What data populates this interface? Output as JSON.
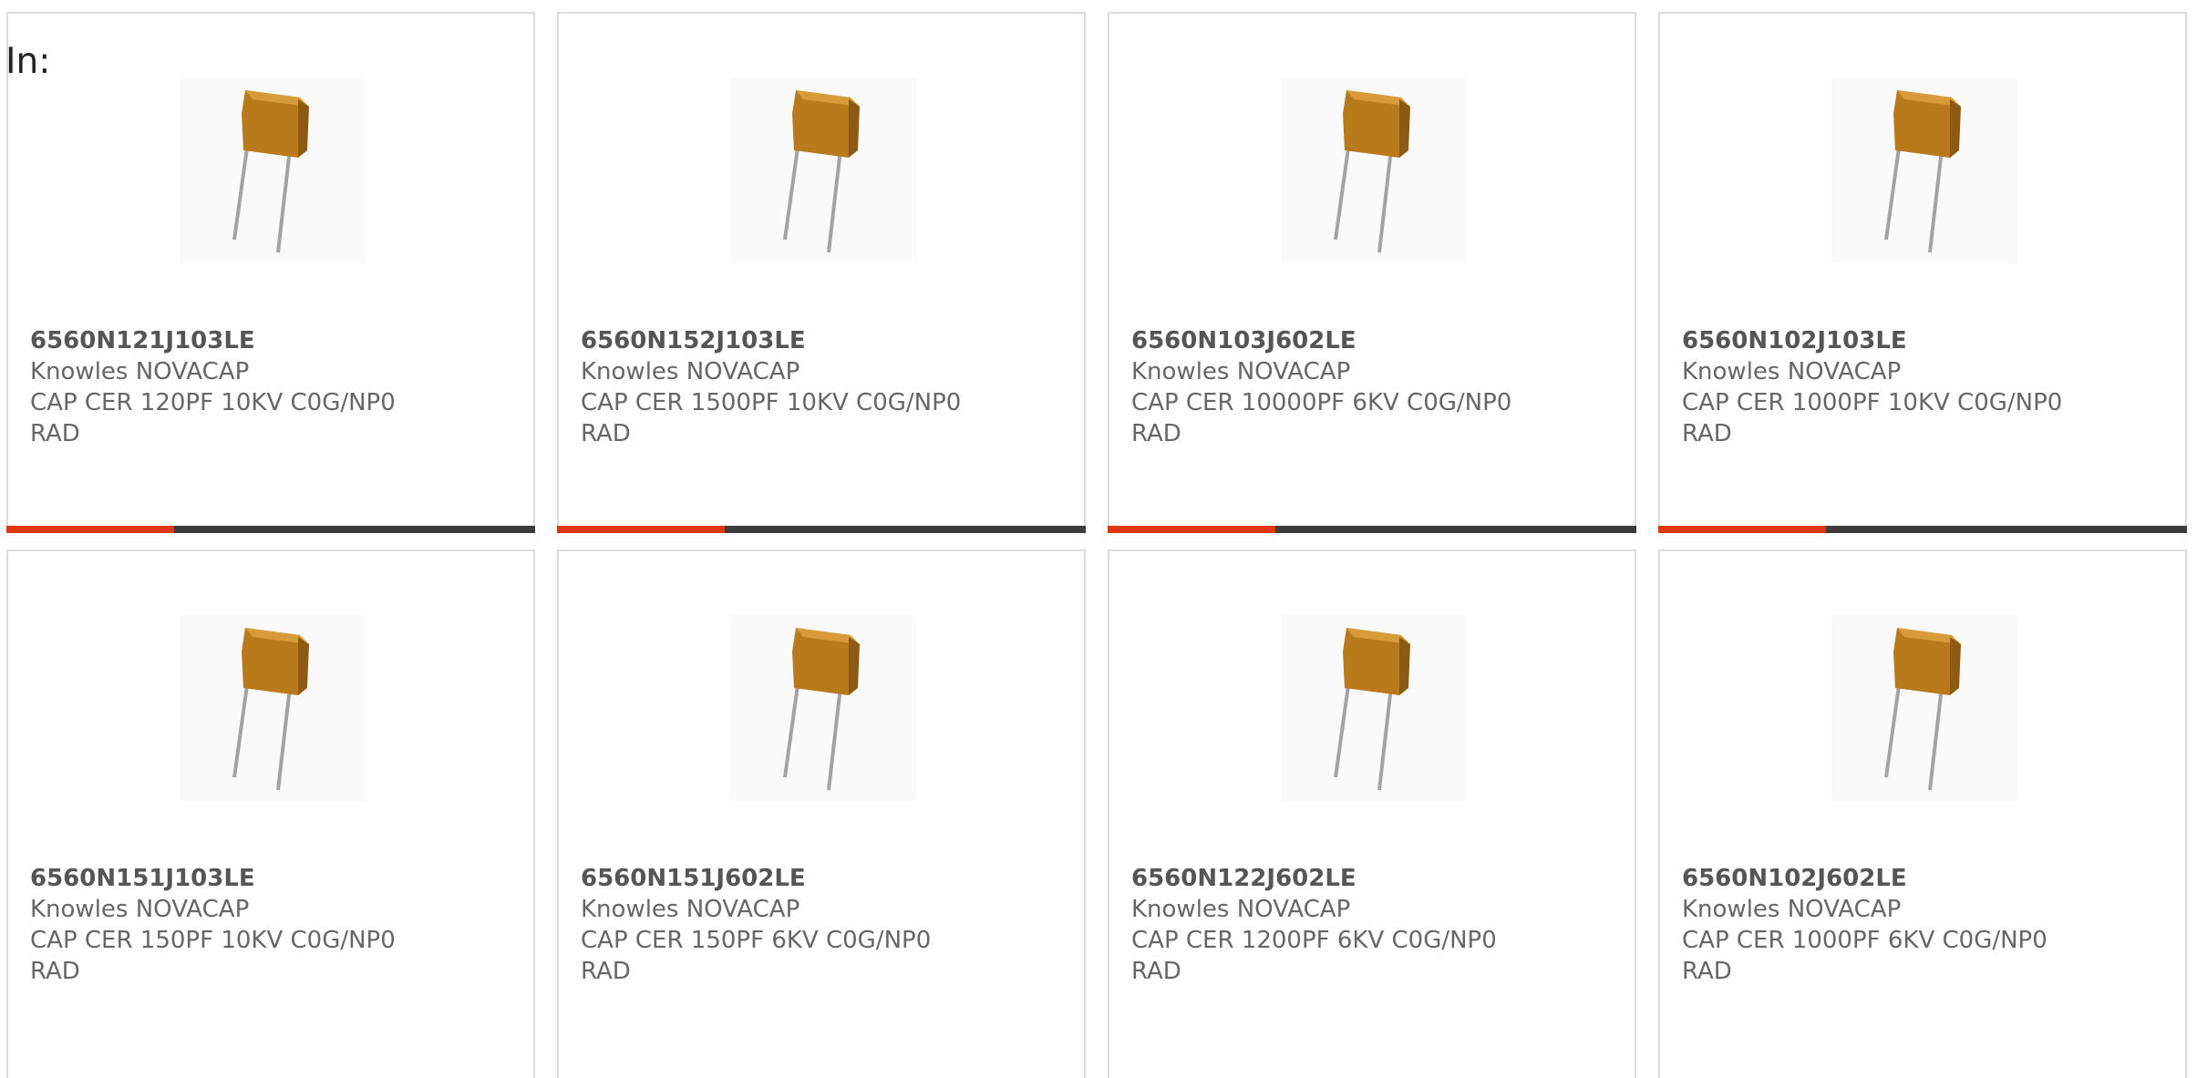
{
  "header": {
    "in_label": "In:"
  },
  "colors": {
    "accent": "#e1360e",
    "bar": "#3c3c3c",
    "body_tan": "#b97a1c"
  },
  "products": [
    {
      "part_number": "6560N121J103LE",
      "manufacturer": "Knowles NOVACAP",
      "desc_line1": "CAP CER 120PF 10KV C0G/NP0",
      "desc_line2": "RAD",
      "image_icon": "radial-capacitor-icon",
      "show_bar": true
    },
    {
      "part_number": "6560N152J103LE",
      "manufacturer": "Knowles NOVACAP",
      "desc_line1": "CAP CER 1500PF 10KV C0G/NP0",
      "desc_line2": "RAD",
      "image_icon": "radial-capacitor-icon",
      "show_bar": true
    },
    {
      "part_number": "6560N103J602LE",
      "manufacturer": "Knowles NOVACAP",
      "desc_line1": "CAP CER 10000PF 6KV C0G/NP0",
      "desc_line2": "RAD",
      "image_icon": "radial-capacitor-icon",
      "show_bar": true
    },
    {
      "part_number": "6560N102J103LE",
      "manufacturer": "Knowles NOVACAP",
      "desc_line1": "CAP CER 1000PF 10KV C0G/NP0",
      "desc_line2": "RAD",
      "image_icon": "radial-capacitor-icon",
      "show_bar": true
    },
    {
      "part_number": "6560N151J103LE",
      "manufacturer": "Knowles NOVACAP",
      "desc_line1": "CAP CER 150PF 10KV C0G/NP0",
      "desc_line2": "RAD",
      "image_icon": "radial-capacitor-icon",
      "show_bar": false
    },
    {
      "part_number": "6560N151J602LE",
      "manufacturer": "Knowles NOVACAP",
      "desc_line1": "CAP CER 150PF 6KV C0G/NP0",
      "desc_line2": "RAD",
      "image_icon": "radial-capacitor-icon",
      "show_bar": false
    },
    {
      "part_number": "6560N122J602LE",
      "manufacturer": "Knowles NOVACAP",
      "desc_line1": "CAP CER 1200PF 6KV C0G/NP0",
      "desc_line2": "RAD",
      "image_icon": "radial-capacitor-icon",
      "show_bar": false
    },
    {
      "part_number": "6560N102J602LE",
      "manufacturer": "Knowles NOVACAP",
      "desc_line1": "CAP CER 1000PF 6KV C0G/NP0",
      "desc_line2": "RAD",
      "image_icon": "radial-capacitor-icon",
      "show_bar": false
    }
  ]
}
